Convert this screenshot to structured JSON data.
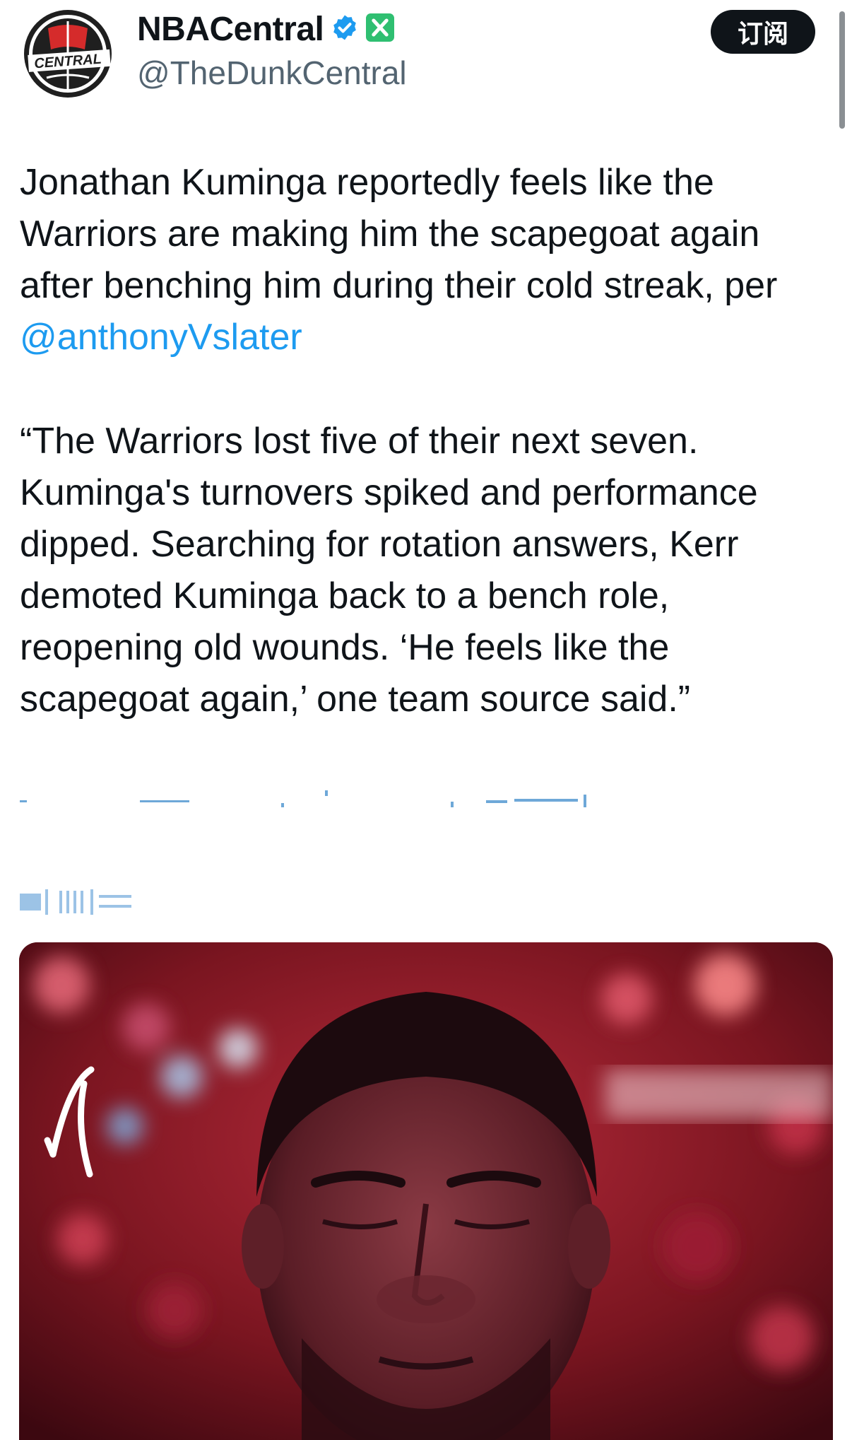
{
  "header": {
    "display_name": "NBACentral",
    "handle": "@TheDunkCentral",
    "avatar_text": "CENTRAL",
    "subscribe_label": "订阅"
  },
  "tweet": {
    "paragraph1": "Jonathan Kuminga reportedly feels like the\nWarriors are making him the scapegoat again\nafter benching him during their cold streak, per\n",
    "mention": "@anthonyVslater",
    "quote": "“The Warriors lost five of their next seven.\nKuminga's turnovers spiked and performance\ndipped. Searching for rotation answers, Kerr\ndemoted Kuminga back to a bench role,\nreopening old wounds. ‘He feels like the\nscapegoat again,’ one team source said.”"
  },
  "colors": {
    "accent": "#1d9bf0",
    "verified_badge": "#1d9bf0",
    "x_badge": "#2fbf71",
    "text": "#0f1419",
    "secondary_text": "#536471",
    "button_bg": "#0f1419"
  },
  "icons": {
    "verified": "verified-badge-icon",
    "platform": "x-logo-icon"
  }
}
